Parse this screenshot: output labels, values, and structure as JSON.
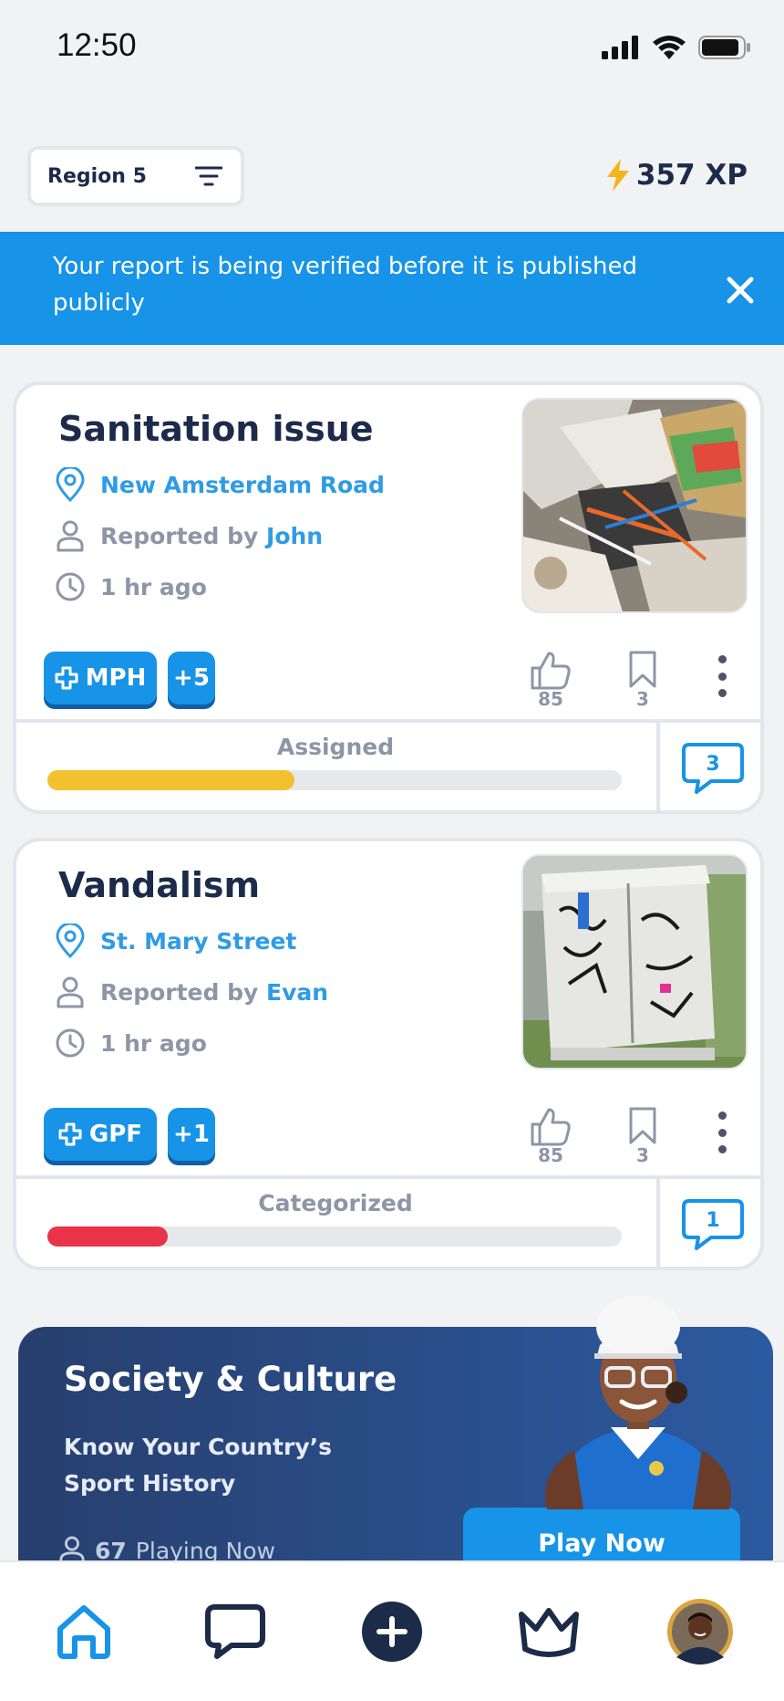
{
  "status_bar": {
    "time": "12:50"
  },
  "header": {
    "region_label": "Region 5",
    "xp_label": "357 XP"
  },
  "banner": {
    "text": "Your report is being verified before it is published publicly"
  },
  "reports": [
    {
      "title": "Sanitation issue",
      "location": "New Amsterdam Road",
      "reported_by_prefix": "Reported by",
      "reporter": "John",
      "time_ago": "1 hr ago",
      "agency": "MPH",
      "extra_agencies": "+5",
      "likes": "85",
      "bookmarks": "3",
      "status": "Assigned",
      "progress": 0.43,
      "progress_color": "#f3c02e",
      "comments": "3"
    },
    {
      "title": "Vandalism",
      "location": "St. Mary Street",
      "reported_by_prefix": "Reported by",
      "reporter": "Evan",
      "time_ago": "1 hr ago",
      "agency": "GPF",
      "extra_agencies": "+1",
      "likes": "85",
      "bookmarks": "3",
      "status": "Categorized",
      "progress": 0.21,
      "progress_color": "#e8334a",
      "comments": "1"
    }
  ],
  "promo": {
    "title": "Society & Culture",
    "subtitle": "Know Your Country’s Sport History",
    "players_count": "67",
    "players_label": "Playing Now",
    "play_button": "Play Now"
  },
  "nav": {
    "items": [
      "home-icon",
      "chat-icon",
      "add-icon",
      "crown-icon",
      "avatar"
    ]
  },
  "colors": {
    "accent": "#1793e8",
    "navy": "#1d2b4a",
    "muted": "#8d96a6"
  }
}
